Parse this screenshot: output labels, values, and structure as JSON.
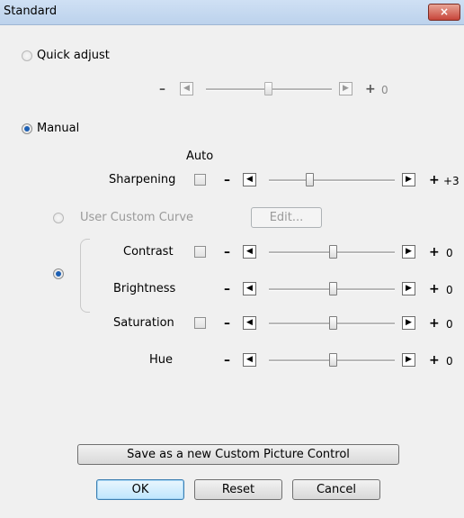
{
  "window": {
    "title": "Standard",
    "close_icon": "×"
  },
  "quick_adjust": {
    "label": "Quick adjust",
    "value": "0",
    "minus": "–",
    "plus": "+",
    "position": 0.5
  },
  "manual": {
    "label": "Manual"
  },
  "auto_header": "Auto",
  "sharpening": {
    "label": "Sharpening",
    "minus": "–",
    "plus": "+",
    "value": "+3",
    "position": 0.33
  },
  "custom_curve": {
    "label": "User Custom Curve",
    "edit_label": "Edit..."
  },
  "contrast": {
    "label": "Contrast",
    "minus": "–",
    "plus": "+",
    "value": "0",
    "position": 0.5
  },
  "brightness": {
    "label": "Brightness",
    "minus": "–",
    "plus": "+",
    "value": "0",
    "position": 0.5
  },
  "saturation": {
    "label": "Saturation",
    "minus": "–",
    "plus": "+",
    "value": "0",
    "position": 0.5
  },
  "hue": {
    "label": "Hue",
    "minus": "–",
    "plus": "+",
    "value": "0",
    "position": 0.5
  },
  "buttons": {
    "save_new": "Save as a new Custom Picture Control",
    "ok": "OK",
    "reset": "Reset",
    "cancel": "Cancel"
  },
  "icons": {
    "left_arrow": "◀",
    "right_arrow": "▶"
  }
}
